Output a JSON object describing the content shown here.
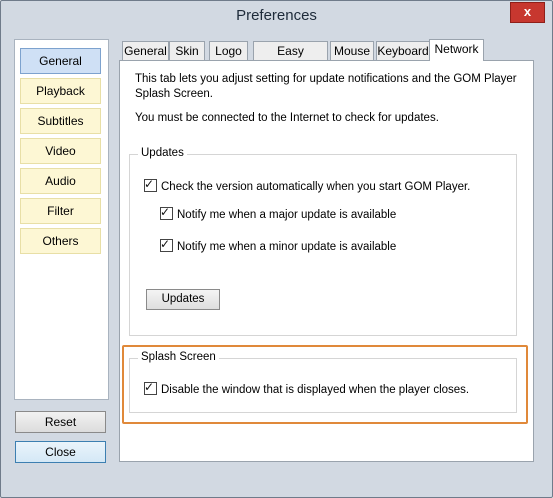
{
  "window": {
    "title": "Preferences",
    "close_glyph": "x"
  },
  "categories": [
    {
      "label": "General"
    },
    {
      "label": "Playback"
    },
    {
      "label": "Subtitles"
    },
    {
      "label": "Video"
    },
    {
      "label": "Audio"
    },
    {
      "label": "Filter"
    },
    {
      "label": "Others"
    }
  ],
  "side_buttons": {
    "reset": "Reset",
    "close": "Close"
  },
  "tabs": [
    {
      "label": "General"
    },
    {
      "label": "Skin"
    },
    {
      "label": "Logo"
    },
    {
      "label": "Easy Browser"
    },
    {
      "label": "Mouse"
    },
    {
      "label": "Keyboard"
    },
    {
      "label": "Network"
    }
  ],
  "network": {
    "description": "This tab lets you adjust setting for update notifications and the GOM Player Splash Screen.",
    "connection_note": "You must be connected to the Internet to check for updates.",
    "updates_group": {
      "legend": "Updates",
      "check_auto": {
        "label": "Check the version automatically when you start GOM Player.",
        "checked": true
      },
      "notify_major": {
        "label": "Notify me when a major update is available",
        "checked": true
      },
      "notify_minor": {
        "label": "Notify me when a minor update is available",
        "checked": true
      },
      "button": "Updates"
    },
    "splash_group": {
      "legend": "Splash Screen",
      "disable_window": {
        "label": "Disable the window that is displayed when the player closes.",
        "checked": true
      }
    }
  },
  "colors": {
    "highlight": "#e0893a",
    "active_category": "#cfe0f5",
    "category": "#fdf7d4",
    "close_button": "#c7372f"
  },
  "check_glyph": "✓"
}
